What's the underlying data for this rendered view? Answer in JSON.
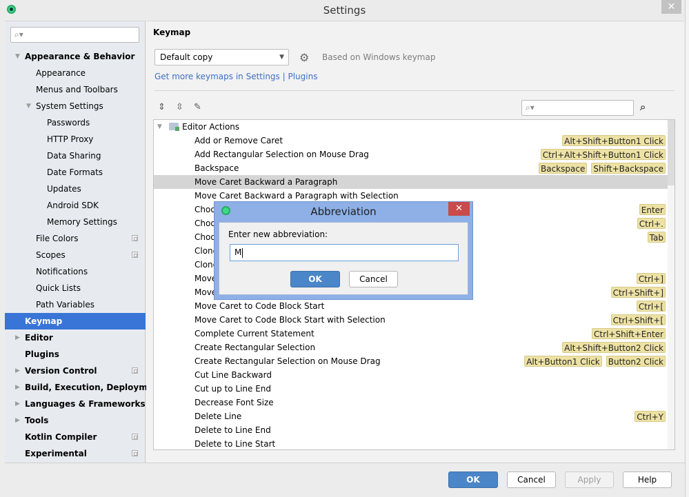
{
  "window": {
    "title": "Settings",
    "close_glyph": "✕"
  },
  "sidebar": {
    "search_placeholder": "",
    "items": [
      {
        "label": "Appearance & Behavior",
        "level": 0,
        "bold": true,
        "expanded": true
      },
      {
        "label": "Appearance",
        "level": 1
      },
      {
        "label": "Menus and Toolbars",
        "level": 1
      },
      {
        "label": "System Settings",
        "level": 1,
        "expanded": true
      },
      {
        "label": "Passwords",
        "level": 2
      },
      {
        "label": "HTTP Proxy",
        "level": 2
      },
      {
        "label": "Data Sharing",
        "level": 2
      },
      {
        "label": "Date Formats",
        "level": 2
      },
      {
        "label": "Updates",
        "level": 2
      },
      {
        "label": "Android SDK",
        "level": 2
      },
      {
        "label": "Memory Settings",
        "level": 2
      },
      {
        "label": "File Colors",
        "level": 1,
        "project": true
      },
      {
        "label": "Scopes",
        "level": 1,
        "project": true
      },
      {
        "label": "Notifications",
        "level": 1
      },
      {
        "label": "Quick Lists",
        "level": 1
      },
      {
        "label": "Path Variables",
        "level": 1
      },
      {
        "label": "Keymap",
        "level": 0,
        "bold": true,
        "selected": true
      },
      {
        "label": "Editor",
        "level": 0,
        "bold": true,
        "collapsed": true
      },
      {
        "label": "Plugins",
        "level": 0,
        "bold": true
      },
      {
        "label": "Version Control",
        "level": 0,
        "bold": true,
        "collapsed": true,
        "project": true
      },
      {
        "label": "Build, Execution, Deployment",
        "level": 0,
        "bold": true,
        "collapsed": true
      },
      {
        "label": "Languages & Frameworks",
        "level": 0,
        "bold": true,
        "collapsed": true
      },
      {
        "label": "Tools",
        "level": 0,
        "bold": true,
        "collapsed": true
      },
      {
        "label": "Kotlin Compiler",
        "level": 0,
        "bold": true,
        "project": true
      },
      {
        "label": "Experimental",
        "level": 0,
        "bold": true,
        "project": true
      }
    ]
  },
  "keymap": {
    "section_title": "Keymap",
    "selected_keymap": "Default copy",
    "based_on": "Based on Windows keymap",
    "more_link": "Get more keymaps in Settings | Plugins",
    "action_search_placeholder": "",
    "tree": {
      "group": "Editor Actions",
      "actions": [
        {
          "name": "Add or Remove Caret",
          "shortcuts": [
            "Alt+Shift+Button1 Click"
          ]
        },
        {
          "name": "Add Rectangular Selection on Mouse Drag",
          "shortcuts": [
            "Ctrl+Alt+Shift+Button1 Click"
          ]
        },
        {
          "name": "Backspace",
          "shortcuts": [
            "Backspace",
            "Shift+Backspace"
          ]
        },
        {
          "name": "Move Caret Backward a Paragraph",
          "shortcuts": [],
          "selected": true
        },
        {
          "name": "Move Caret Backward a Paragraph with Selection",
          "shortcuts": []
        },
        {
          "name": "Choo",
          "shortcuts": [
            "Enter"
          ]
        },
        {
          "name": "Choo",
          "shortcuts": [
            "Ctrl+."
          ]
        },
        {
          "name": "Choo",
          "shortcuts": [
            "Tab"
          ]
        },
        {
          "name": "Clone",
          "shortcuts": []
        },
        {
          "name": "Clone",
          "shortcuts": []
        },
        {
          "name": "Move",
          "shortcuts": [
            "Ctrl+]"
          ]
        },
        {
          "name": "Move",
          "shortcuts": [
            "Ctrl+Shift+]"
          ]
        },
        {
          "name": "Move Caret to Code Block Start",
          "shortcuts": [
            "Ctrl+["
          ]
        },
        {
          "name": "Move Caret to Code Block Start with Selection",
          "shortcuts": [
            "Ctrl+Shift+["
          ]
        },
        {
          "name": "Complete Current Statement",
          "shortcuts": [
            "Ctrl+Shift+Enter"
          ]
        },
        {
          "name": "Create Rectangular Selection",
          "shortcuts": [
            "Alt+Shift+Button2 Click"
          ]
        },
        {
          "name": "Create Rectangular Selection on Mouse Drag",
          "shortcuts": [
            "Alt+Button1 Click",
            "Button2 Click"
          ]
        },
        {
          "name": "Cut Line Backward",
          "shortcuts": []
        },
        {
          "name": "Cut up to Line End",
          "shortcuts": []
        },
        {
          "name": "Decrease Font Size",
          "shortcuts": []
        },
        {
          "name": "Delete Line",
          "shortcuts": [
            "Ctrl+Y"
          ]
        },
        {
          "name": "Delete to Line End",
          "shortcuts": []
        },
        {
          "name": "Delete to Line Start",
          "shortcuts": []
        }
      ]
    }
  },
  "footer": {
    "ok": "OK",
    "cancel": "Cancel",
    "apply": "Apply",
    "help": "Help"
  },
  "dialog": {
    "title": "Abbreviation",
    "prompt": "Enter new abbreviation:",
    "input_value": "M",
    "ok": "OK",
    "cancel": "Cancel",
    "close_glyph": "✕"
  },
  "colors": {
    "selection": "#3875d6",
    "shortcut_badge": "#ede2a4",
    "link": "#3e6fc4",
    "primary_button": "#4a86c8"
  }
}
